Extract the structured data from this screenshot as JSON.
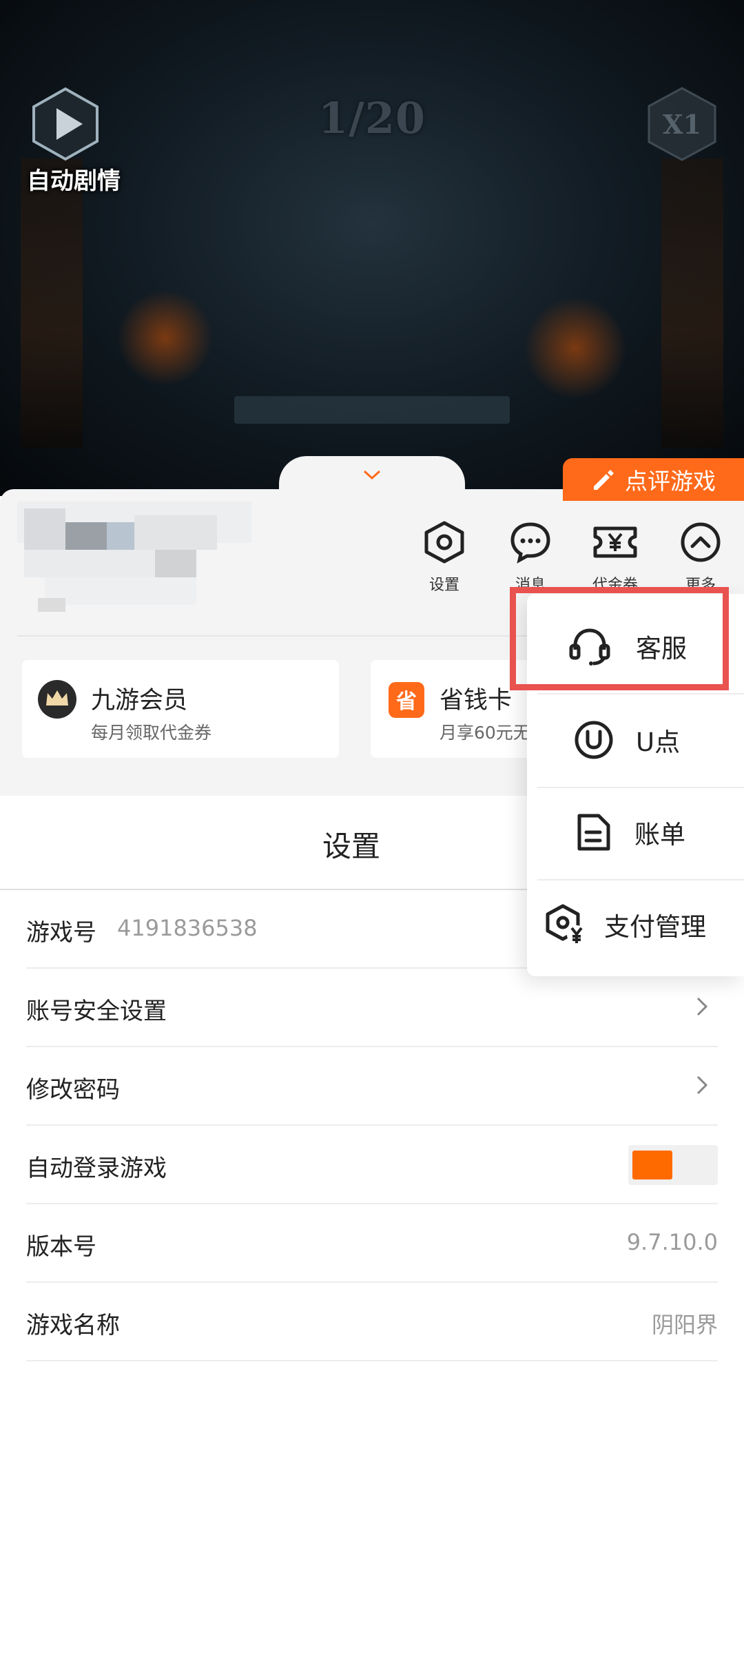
{
  "game": {
    "auto_story_label": "自动剧情",
    "page_counter": "1/20",
    "speed_icon": "speed-x1-icon"
  },
  "panel": {
    "review_button": "点评游戏",
    "top_icons": [
      {
        "label": "设置",
        "icon": "hexagon-settings-icon"
      },
      {
        "label": "消息",
        "icon": "chat-bubble-icon"
      },
      {
        "label": "代金券",
        "icon": "voucher-icon"
      },
      {
        "label": "更多",
        "icon": "chevron-up-circle-icon"
      }
    ],
    "cards": [
      {
        "title": "九游会员",
        "subtitle": "每月领取代金券",
        "icon": "crown-icon"
      },
      {
        "title": "省钱卡",
        "subtitle": "月享60元无",
        "icon": "save-card-icon"
      }
    ]
  },
  "settings": {
    "title": "设置",
    "rows": [
      {
        "label": "游戏号",
        "value": "4191836538"
      },
      {
        "label": "账号安全设置"
      },
      {
        "label": "修改密码"
      },
      {
        "label": "自动登录游戏",
        "toggle_on": true
      },
      {
        "label": "版本号",
        "value": "9.7.10.0"
      },
      {
        "label": "游戏名称",
        "value": "阴阳界"
      }
    ]
  },
  "menu": {
    "items": [
      {
        "label": "客服",
        "icon": "headset-icon"
      },
      {
        "label": "U点",
        "icon": "u-point-icon"
      },
      {
        "label": "账单",
        "icon": "bill-icon"
      },
      {
        "label": "支付管理",
        "icon": "payment-gear-icon"
      }
    ]
  },
  "colors": {
    "accent": "#ff6a1a",
    "highlight": "#e8524f",
    "toggle_on": "#ff6a00"
  }
}
